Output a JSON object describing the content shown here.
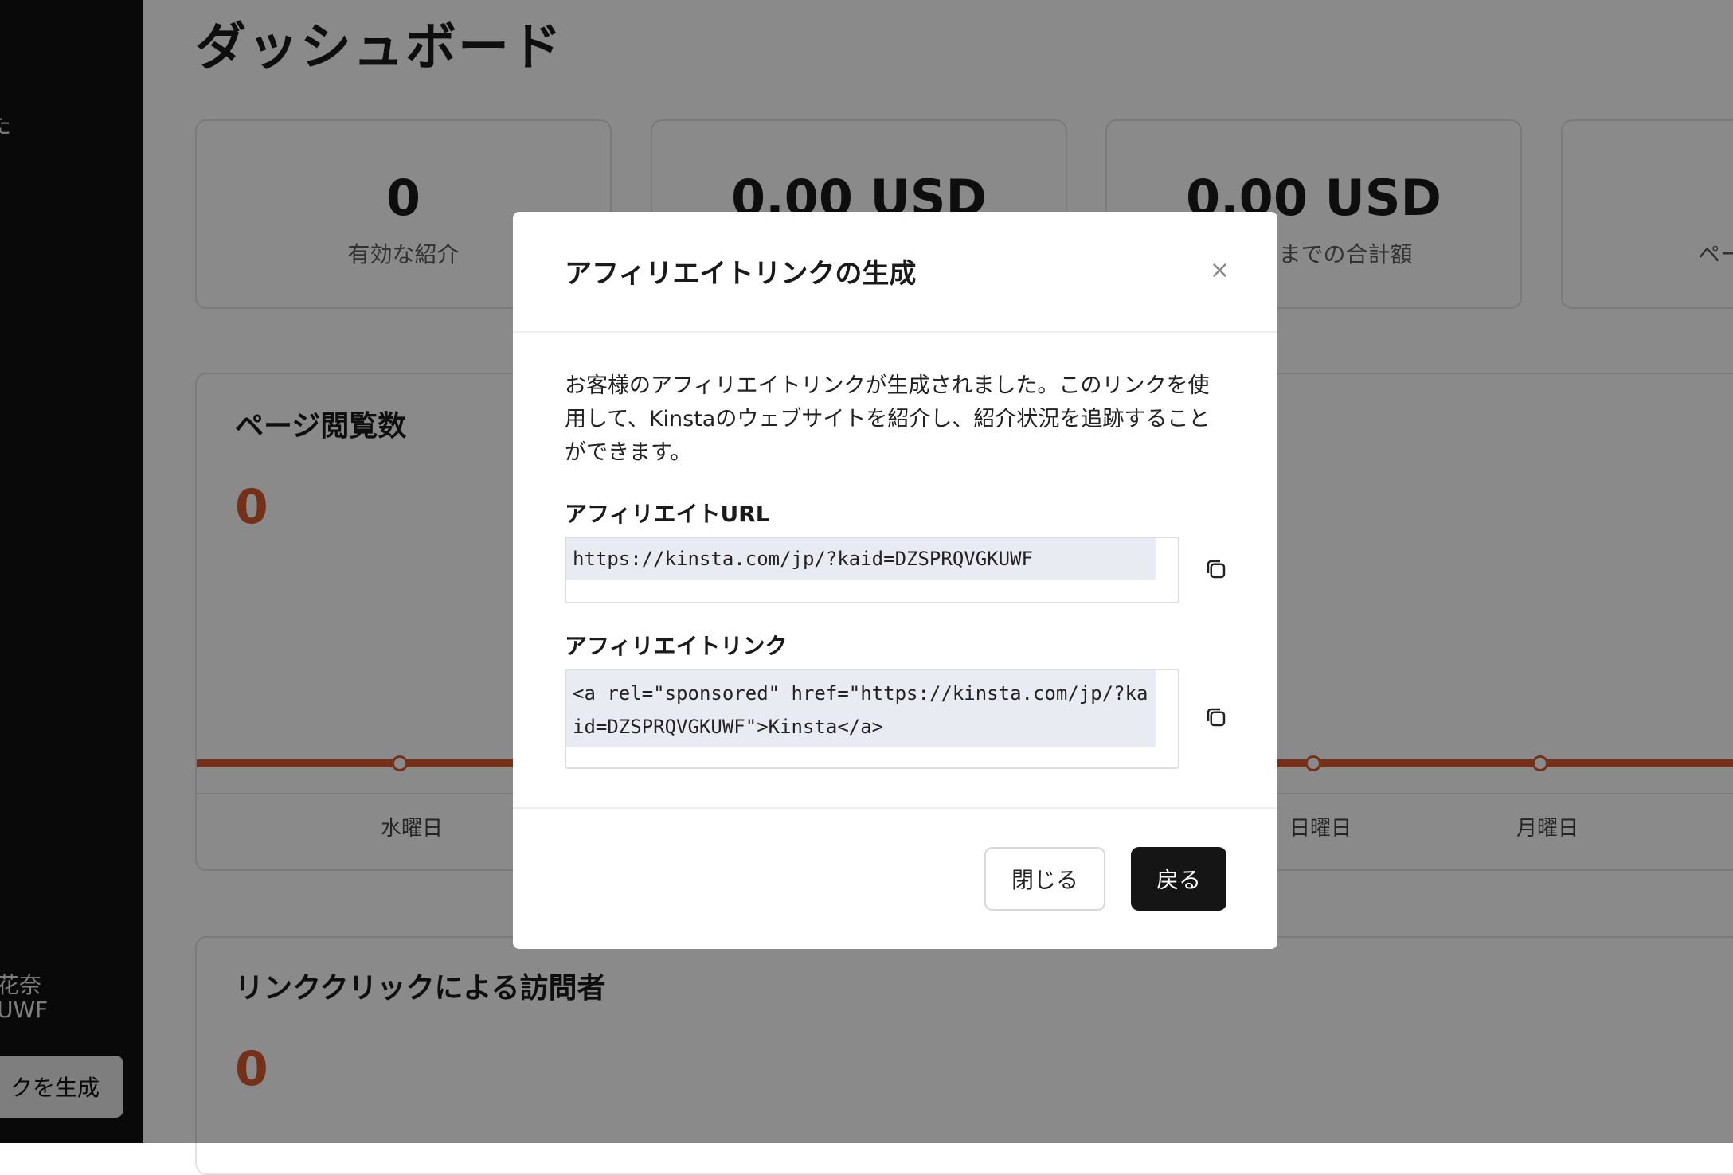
{
  "sidebar": {
    "user_name": "花奈",
    "affiliate_id_fragment": "UWF",
    "top_fragment": "た",
    "generate_button": "クを生成"
  },
  "page": {
    "title": "ダッシュボード"
  },
  "stats": [
    {
      "value": "0",
      "label": "有効な紹介"
    },
    {
      "value": "0.00 USD",
      "label": ""
    },
    {
      "value": "0.00 USD",
      "label": "までの合計額"
    },
    {
      "value": "",
      "label": "ペー"
    }
  ],
  "page_views": {
    "title": "ページ閲覧数",
    "value": "0",
    "days": [
      "水曜日",
      "日曜日",
      "月曜日"
    ]
  },
  "link_clicks": {
    "title": "リンククリックによる訪問者",
    "value": "0"
  },
  "modal": {
    "title": "アフィリエイトリンクの生成",
    "close_icon": "×",
    "description": "お客様のアフィリエイトリンクが生成されました。このリンクを使用して、Kinstaのウェブサイトを紹介し、紹介状況を追跡することができます。",
    "url_label": "アフィリエイトURL",
    "url_value": "https://kinsta.com/jp/?kaid=DZSPRQVGKUWF",
    "link_label": "アフィリエイトリンク",
    "link_value": "<a rel=\"sponsored\" href=\"https://kinsta.com/jp/?kaid=DZSPRQVGKUWF\">Kinsta</a>",
    "close_button": "閉じる",
    "back_button": "戻る"
  }
}
